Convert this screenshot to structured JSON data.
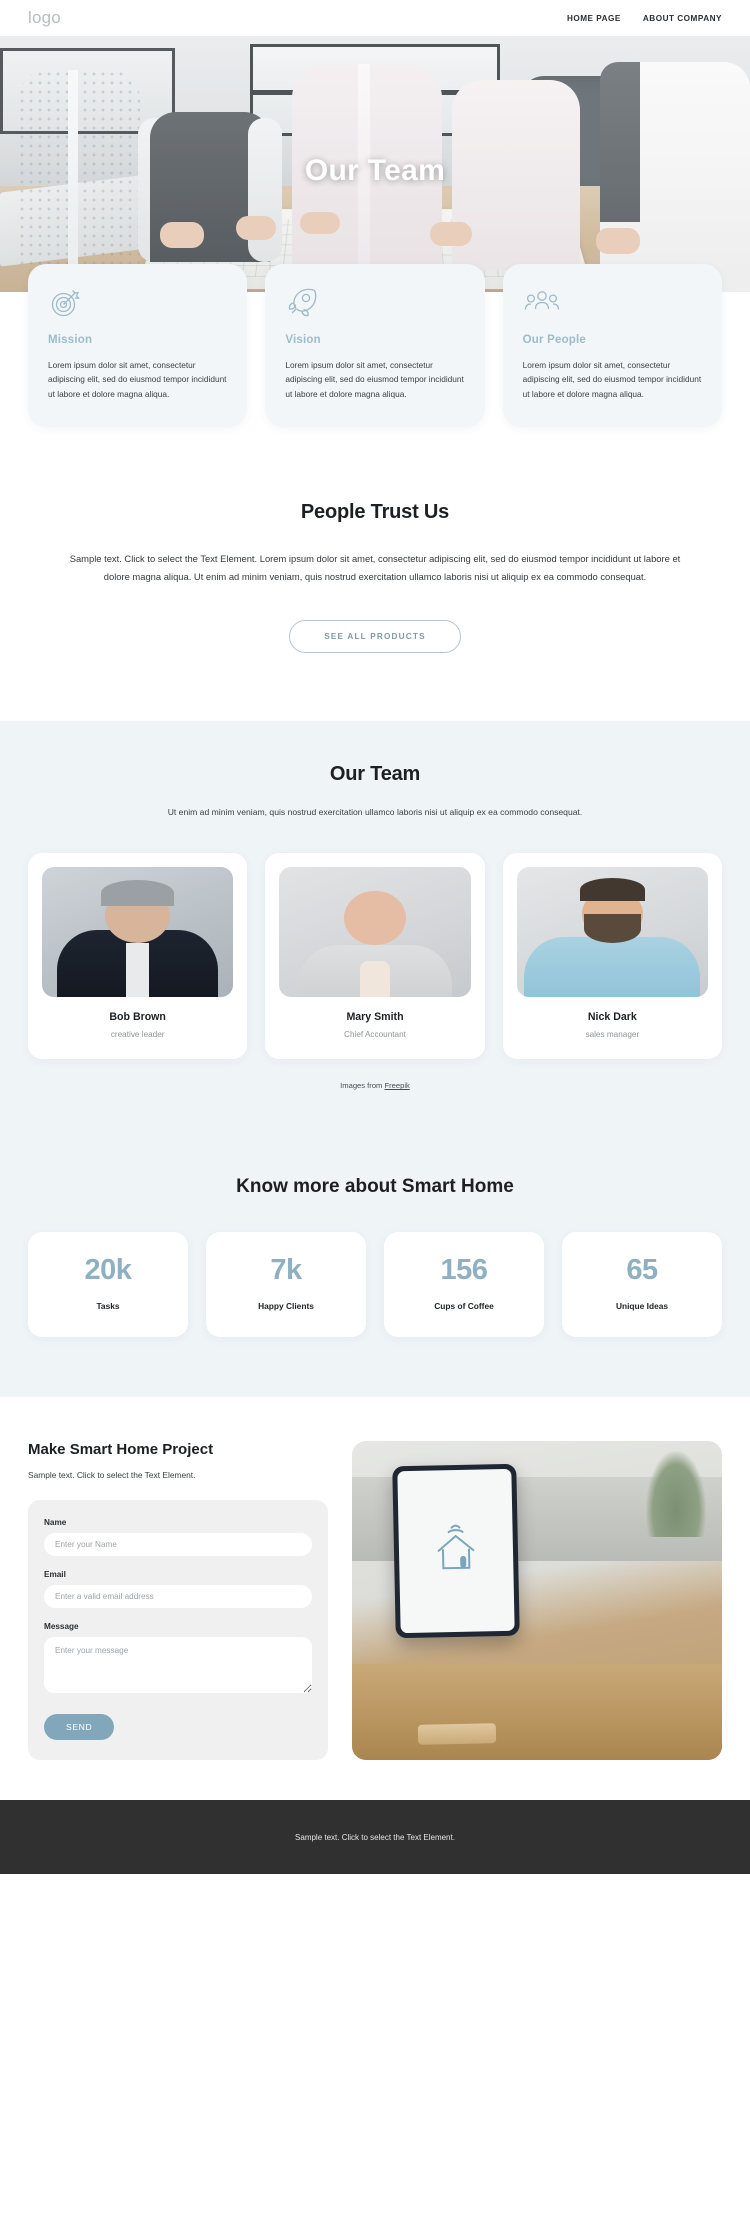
{
  "header": {
    "logo": "logo",
    "nav": [
      {
        "label": "HOME PAGE"
      },
      {
        "label": "ABOUT COMPANY"
      }
    ]
  },
  "hero": {
    "title": "Our Team"
  },
  "features": [
    {
      "icon": "target-icon",
      "title": "Mission",
      "text": "Lorem ipsum dolor sit amet, consectetur adipiscing elit, sed do eiusmod tempor incididunt ut labore et dolore magna aliqua."
    },
    {
      "icon": "rocket-icon",
      "title": "Vision",
      "text": "Lorem ipsum dolor sit amet, consectetur adipiscing elit, sed do eiusmod tempor incididunt ut labore et dolore magna aliqua."
    },
    {
      "icon": "people-icon",
      "title": "Our People",
      "text": "Lorem ipsum dolor sit amet, consectetur adipiscing elit, sed do eiusmod tempor incididunt ut labore et dolore magna aliqua."
    }
  ],
  "trust": {
    "title": "People Trust Us",
    "text": "Sample text. Click to select the Text Element. Lorem ipsum dolor sit amet, consectetur adipiscing elit, sed do eiusmod tempor incididunt ut labore et dolore magna aliqua. Ut enim ad minim veniam, quis nostrud exercitation ullamco laboris nisi ut aliquip ex ea commodo consequat.",
    "button": "SEE ALL PRODUCTS"
  },
  "team": {
    "title": "Our Team",
    "subtitle": "Ut enim ad minim veniam, quis nostrud exercitation ullamco laboris nisi ut aliquip ex ea commodo consequat.",
    "members": [
      {
        "name": "Bob Brown",
        "role": "creative leader"
      },
      {
        "name": "Mary Smith",
        "role": "Chief Accountant"
      },
      {
        "name": "Nick Dark",
        "role": "sales manager"
      }
    ],
    "credit_prefix": "Images from ",
    "credit_link": "Freepik"
  },
  "stats": {
    "title": "Know more about Smart Home",
    "items": [
      {
        "value": "20k",
        "label": "Tasks"
      },
      {
        "value": "7k",
        "label": "Happy Clients"
      },
      {
        "value": "156",
        "label": "Cups of Coffee"
      },
      {
        "value": "65",
        "label": "Unique Ideas"
      }
    ]
  },
  "contact": {
    "title": "Make Smart Home Project",
    "subtitle": "Sample text. Click to select the Text Element.",
    "fields": {
      "name_label": "Name",
      "name_placeholder": "Enter your Name",
      "email_label": "Email",
      "email_placeholder": "Enter a valid email address",
      "message_label": "Message",
      "message_placeholder": "Enter your message"
    },
    "send_button": "SEND"
  },
  "footer": {
    "text": "Sample text. Click to select the Text Element."
  },
  "colors": {
    "accent": "#8eb0c1",
    "feature_title": "#9cbccb",
    "panel_bg": "#eff4f7",
    "card_bg": "#f2f6f8",
    "footer_bg": "#303030",
    "send_button": "#82a7bb"
  }
}
